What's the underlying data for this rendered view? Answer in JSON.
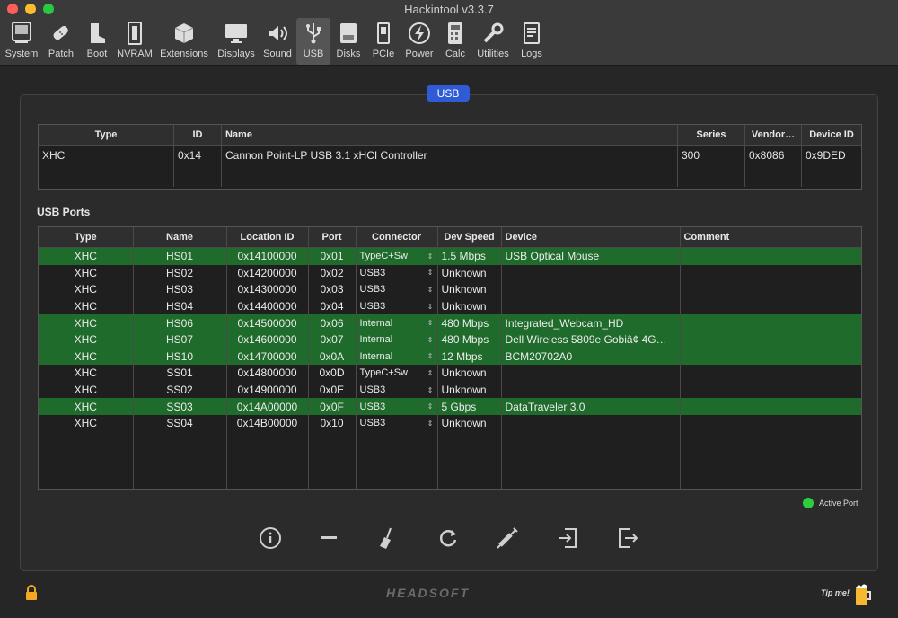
{
  "window": {
    "title": "Hackintool v3.3.7"
  },
  "toolbar": {
    "items": [
      {
        "label": "System",
        "icon": "system-icon"
      },
      {
        "label": "Patch",
        "icon": "patch-icon"
      },
      {
        "label": "Boot",
        "icon": "boot-icon"
      },
      {
        "label": "NVRAM",
        "icon": "nvram-icon"
      },
      {
        "label": "Extensions",
        "icon": "extensions-icon"
      },
      {
        "label": "Displays",
        "icon": "displays-icon"
      },
      {
        "label": "Sound",
        "icon": "sound-icon"
      },
      {
        "label": "USB",
        "icon": "usb-icon"
      },
      {
        "label": "Disks",
        "icon": "disks-icon"
      },
      {
        "label": "PCIe",
        "icon": "pcie-icon"
      },
      {
        "label": "Power",
        "icon": "power-icon"
      },
      {
        "label": "Calc",
        "icon": "calc-icon"
      },
      {
        "label": "Utilities",
        "icon": "utilities-icon"
      },
      {
        "label": "Logs",
        "icon": "logs-icon"
      }
    ],
    "active": "USB"
  },
  "section_tab": "USB",
  "controllers": {
    "headers": [
      "Type",
      "ID",
      "Name",
      "Series",
      "Vendor…",
      "Device ID"
    ],
    "rows": [
      [
        "XHC",
        "0x14",
        "Cannon Point-LP USB 3.1 xHCI Controller",
        "300",
        "0x8086",
        "0x9DED"
      ]
    ]
  },
  "ports": {
    "title": "USB Ports",
    "headers": [
      "Type",
      "Name",
      "Location ID",
      "Port",
      "Connector",
      "Dev Speed",
      "Device",
      "Comment"
    ],
    "rows": [
      {
        "type": "XHC",
        "name": "HS01",
        "location": "0x14100000",
        "port": "0x01",
        "connector": "TypeC+Sw",
        "speed": "1.5 Mbps",
        "device": "USB Optical Mouse",
        "comment": "",
        "active": true
      },
      {
        "type": "XHC",
        "name": "HS02",
        "location": "0x14200000",
        "port": "0x02",
        "connector": "USB3",
        "speed": "Unknown",
        "device": "",
        "comment": "",
        "active": false
      },
      {
        "type": "XHC",
        "name": "HS03",
        "location": "0x14300000",
        "port": "0x03",
        "connector": "USB3",
        "speed": "Unknown",
        "device": "",
        "comment": "",
        "active": false
      },
      {
        "type": "XHC",
        "name": "HS04",
        "location": "0x14400000",
        "port": "0x04",
        "connector": "USB3",
        "speed": "Unknown",
        "device": "",
        "comment": "",
        "active": false
      },
      {
        "type": "XHC",
        "name": "HS06",
        "location": "0x14500000",
        "port": "0x06",
        "connector": "Internal",
        "speed": "480 Mbps",
        "device": "Integrated_Webcam_HD",
        "comment": "",
        "active": true
      },
      {
        "type": "XHC",
        "name": "HS07",
        "location": "0x14600000",
        "port": "0x07",
        "connector": "Internal",
        "speed": "480 Mbps",
        "device": "Dell Wireless 5809e Gobiâ¢ 4G…",
        "comment": "",
        "active": true
      },
      {
        "type": "XHC",
        "name": "HS10",
        "location": "0x14700000",
        "port": "0x0A",
        "connector": "Internal",
        "speed": "12 Mbps",
        "device": "BCM20702A0",
        "comment": "",
        "active": true
      },
      {
        "type": "XHC",
        "name": "SS01",
        "location": "0x14800000",
        "port": "0x0D",
        "connector": "TypeC+Sw",
        "speed": "Unknown",
        "device": "",
        "comment": "",
        "active": false
      },
      {
        "type": "XHC",
        "name": "SS02",
        "location": "0x14900000",
        "port": "0x0E",
        "connector": "USB3",
        "speed": "Unknown",
        "device": "",
        "comment": "",
        "active": false
      },
      {
        "type": "XHC",
        "name": "SS03",
        "location": "0x14A00000",
        "port": "0x0F",
        "connector": "USB3",
        "speed": "5 Gbps",
        "device": "DataTraveler 3.0",
        "comment": "",
        "active": true
      },
      {
        "type": "XHC",
        "name": "SS04",
        "location": "0x14B00000",
        "port": "0x10",
        "connector": "USB3",
        "speed": "Unknown",
        "device": "",
        "comment": "",
        "active": false
      }
    ]
  },
  "legend": {
    "label": "Active Port",
    "color": "#2ecc40"
  },
  "actions": [
    "info-icon",
    "minus-icon",
    "broom-icon",
    "refresh-icon",
    "syringe-icon",
    "import-icon",
    "export-icon"
  ],
  "footer": {
    "brand": "HEADSOFT",
    "tip": "Tip me!"
  },
  "colors": {
    "active_row": "#1f6b2c",
    "accent": "#2f5bd6"
  }
}
